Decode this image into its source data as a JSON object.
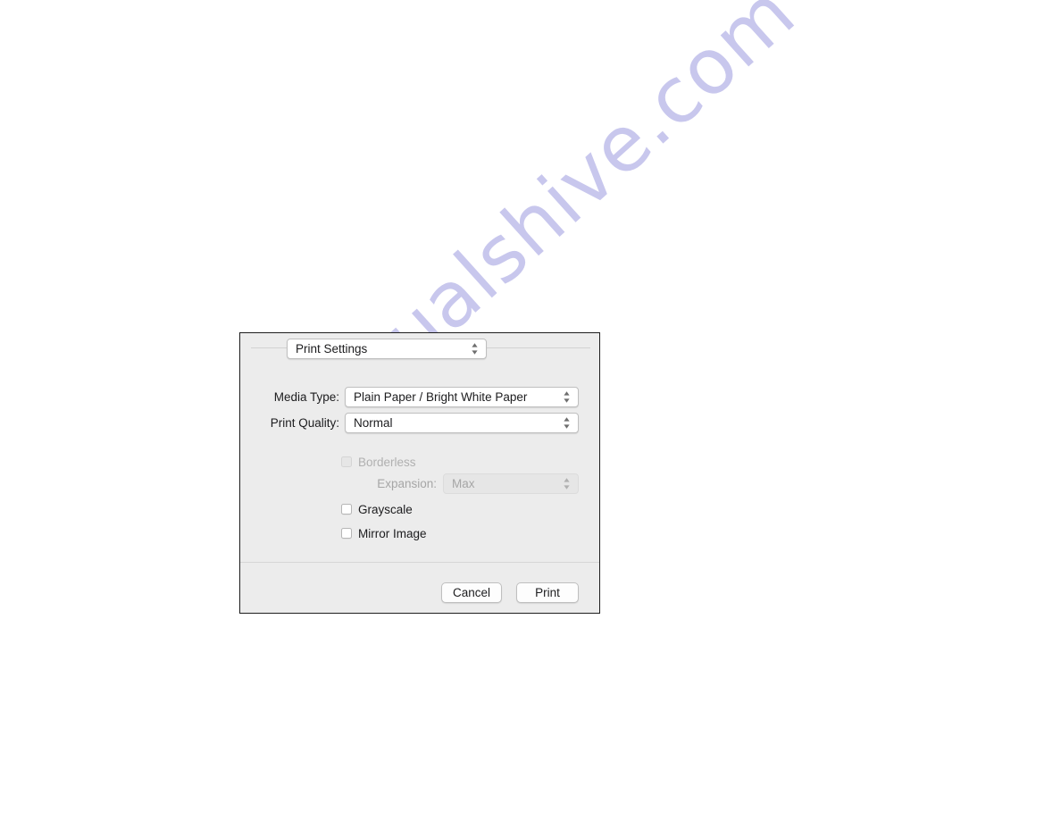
{
  "watermark": {
    "text": "manualshive.com",
    "color": "#b9b8e8"
  },
  "dialog": {
    "name": "print-settings-dialog",
    "background_color": "#ececec",
    "border_color": "#1d1d1d",
    "section_popup": {
      "label": "Print Settings",
      "icon": "stepper-updown-icon",
      "enabled": true
    },
    "fields": [
      {
        "key": "media_type",
        "label": "Media Type:",
        "value": "Plain Paper / Bright White Paper",
        "enabled": true
      },
      {
        "key": "print_quality",
        "label": "Print Quality:",
        "value": "Normal",
        "enabled": true
      }
    ],
    "borderless": {
      "label": "Borderless",
      "checked": false,
      "enabled": false
    },
    "expansion": {
      "label": "Expansion:",
      "value": "Max",
      "enabled": false
    },
    "grayscale": {
      "label": "Grayscale",
      "checked": false,
      "enabled": true
    },
    "mirror_image": {
      "label": "Mirror Image",
      "checked": false,
      "enabled": true
    },
    "buttons": {
      "cancel": "Cancel",
      "print": "Print"
    }
  }
}
